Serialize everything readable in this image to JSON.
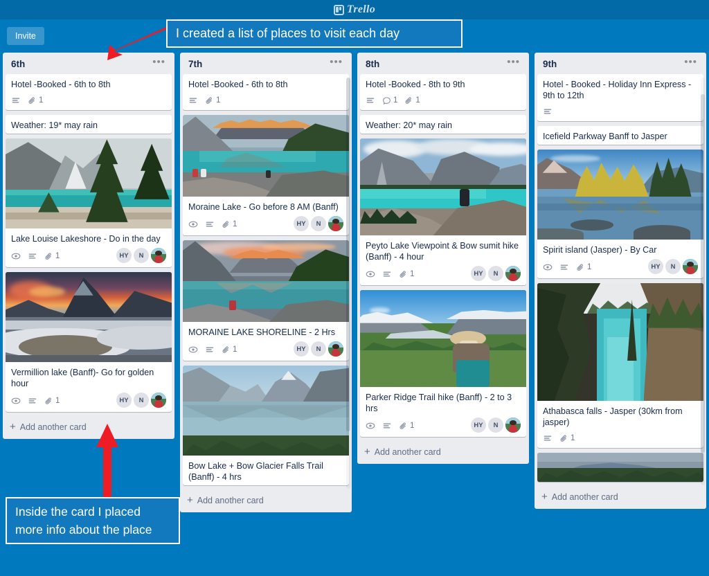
{
  "app": {
    "brand": "Trello",
    "logo_icon": "trello-board-icon"
  },
  "board_header": {
    "invite_label": "Invite"
  },
  "annotations": {
    "top": "I created a list of places to visit each day",
    "bottom": "Inside the card I placed more info about the place",
    "arrow_color": "#ee1c24"
  },
  "add_card_label": "+ Add another card",
  "members": {
    "a": "HY",
    "b": "N",
    "photo": "user-photo-avatar"
  },
  "lists": [
    {
      "title": "6th",
      "menu_icon": "list-menu-icon",
      "add_card": "Add another card",
      "cards": [
        {
          "title": "Hotel -Booked - 6th to 8th",
          "cover": null,
          "badges": {
            "watch": false,
            "description": true,
            "comments": null,
            "attachments": "1"
          },
          "members": false
        },
        {
          "title": "Weather: 19* may rain",
          "cover": null,
          "badges": {
            "watch": false,
            "description": false,
            "comments": null,
            "attachments": null
          },
          "members": false
        },
        {
          "title": "Lake Louise Lakeshore - Do in the day",
          "cover": "lake-louise",
          "badges": {
            "watch": true,
            "description": true,
            "comments": null,
            "attachments": "1"
          },
          "members": true
        },
        {
          "title": "Vermillion lake (Banff)- Go for golden hour",
          "cover": "vermillion",
          "badges": {
            "watch": true,
            "description": true,
            "comments": null,
            "attachments": "1"
          },
          "members": true
        }
      ]
    },
    {
      "title": "7th",
      "menu_icon": "list-menu-icon",
      "add_card": "Add another card",
      "cards": [
        {
          "title": "Hotel -Booked - 6th to 8th",
          "cover": null,
          "badges": {
            "watch": false,
            "description": true,
            "comments": null,
            "attachments": "1"
          },
          "members": false
        },
        {
          "title": "Moraine Lake - Go before 8 AM (Banff)",
          "cover": "moraine-dawn",
          "badges": {
            "watch": true,
            "description": true,
            "comments": null,
            "attachments": "1"
          },
          "members": true
        },
        {
          "title": "MORAINE LAKE SHORELINE - 2 Hrs",
          "cover": "moraine-sunset",
          "badges": {
            "watch": true,
            "description": true,
            "comments": null,
            "attachments": "1"
          },
          "members": true
        },
        {
          "title": "Bow Lake + Bow Glacier Falls Trail (Banff) - 4 hrs",
          "cover": "bow-lake",
          "badges": {
            "watch": false,
            "description": false,
            "comments": null,
            "attachments": null
          },
          "members": false
        }
      ]
    },
    {
      "title": "8th",
      "menu_icon": "list-menu-icon",
      "add_card": "Add another card",
      "cards": [
        {
          "title": "Hotel -Booked - 8th to 9th",
          "cover": null,
          "badges": {
            "watch": false,
            "description": true,
            "comments": "1",
            "attachments": "1"
          },
          "members": false
        },
        {
          "title": "Weather: 20* may rain",
          "cover": null,
          "badges": {
            "watch": false,
            "description": false,
            "comments": null,
            "attachments": null
          },
          "members": false
        },
        {
          "title": "Peyto Lake Viewpoint & Bow sumit hike (Banff) - 4 hour",
          "cover": "peyto",
          "badges": {
            "watch": true,
            "description": true,
            "comments": null,
            "attachments": "1"
          },
          "members": true
        },
        {
          "title": "Parker Ridge Trail hike (Banff) - 2 to 3 hrs",
          "cover": "parker-ridge",
          "badges": {
            "watch": true,
            "description": true,
            "comments": null,
            "attachments": "1"
          },
          "members": true
        }
      ]
    },
    {
      "title": "9th",
      "menu_icon": "list-menu-icon",
      "add_card": "Add another card",
      "cards": [
        {
          "title": "Hotel - Booked - Holiday Inn Express - 9th to 12th",
          "cover": null,
          "badges": {
            "watch": false,
            "description": true,
            "comments": null,
            "attachments": null
          },
          "members": false
        },
        {
          "title": "Icefield Parkway Banff to Jasper",
          "cover": null,
          "badges": {
            "watch": false,
            "description": false,
            "comments": null,
            "attachments": null
          },
          "members": false
        },
        {
          "title": "Spirit island (Jasper) - By Car",
          "cover": "spirit-island",
          "badges": {
            "watch": true,
            "description": true,
            "comments": null,
            "attachments": "1"
          },
          "members": true
        },
        {
          "title": "Athabasca falls - Jasper (30km from jasper)",
          "cover": "athabasca",
          "badges": {
            "watch": false,
            "description": true,
            "comments": null,
            "attachments": "1"
          },
          "members": false
        },
        {
          "title": "",
          "cover": "jasper-partial",
          "badges": {
            "watch": false,
            "description": false,
            "comments": null,
            "attachments": null
          },
          "members": false
        }
      ]
    }
  ],
  "colors": {
    "topbar": "#026aa7",
    "board": "#0079bf",
    "list": "#ebecf0",
    "card": "#ffffff",
    "text": "#172b4d",
    "muted": "#6b778c"
  }
}
